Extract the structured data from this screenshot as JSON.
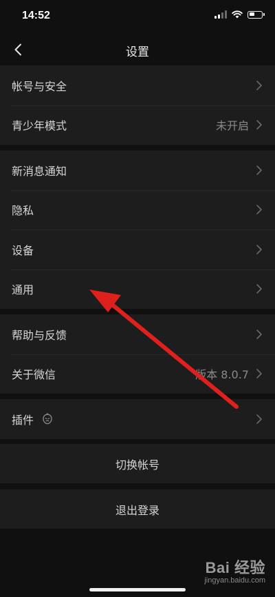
{
  "status_bar": {
    "time": "14:52"
  },
  "nav": {
    "title": "设置"
  },
  "groups": [
    {
      "items": [
        {
          "label": "帐号与安全",
          "value": ""
        },
        {
          "label": "青少年模式",
          "value": "未开启"
        }
      ]
    },
    {
      "items": [
        {
          "label": "新消息通知",
          "value": ""
        },
        {
          "label": "隐私",
          "value": ""
        },
        {
          "label": "设备",
          "value": ""
        },
        {
          "label": "通用",
          "value": ""
        }
      ]
    },
    {
      "items": [
        {
          "label": "帮助与反馈",
          "value": ""
        },
        {
          "label": "关于微信",
          "value": "版本 8.0.7"
        }
      ]
    },
    {
      "items": [
        {
          "label": "插件",
          "value": ""
        }
      ]
    }
  ],
  "actions": {
    "switch_account": "切换帐号",
    "logout": "退出登录"
  },
  "watermark": {
    "logo_text": "Bai 经验",
    "sub_text": "jingyan.baidu.com"
  },
  "colors": {
    "background": "#101010",
    "cell": "#1d1d1d",
    "annotation_arrow": "#e0201c"
  }
}
